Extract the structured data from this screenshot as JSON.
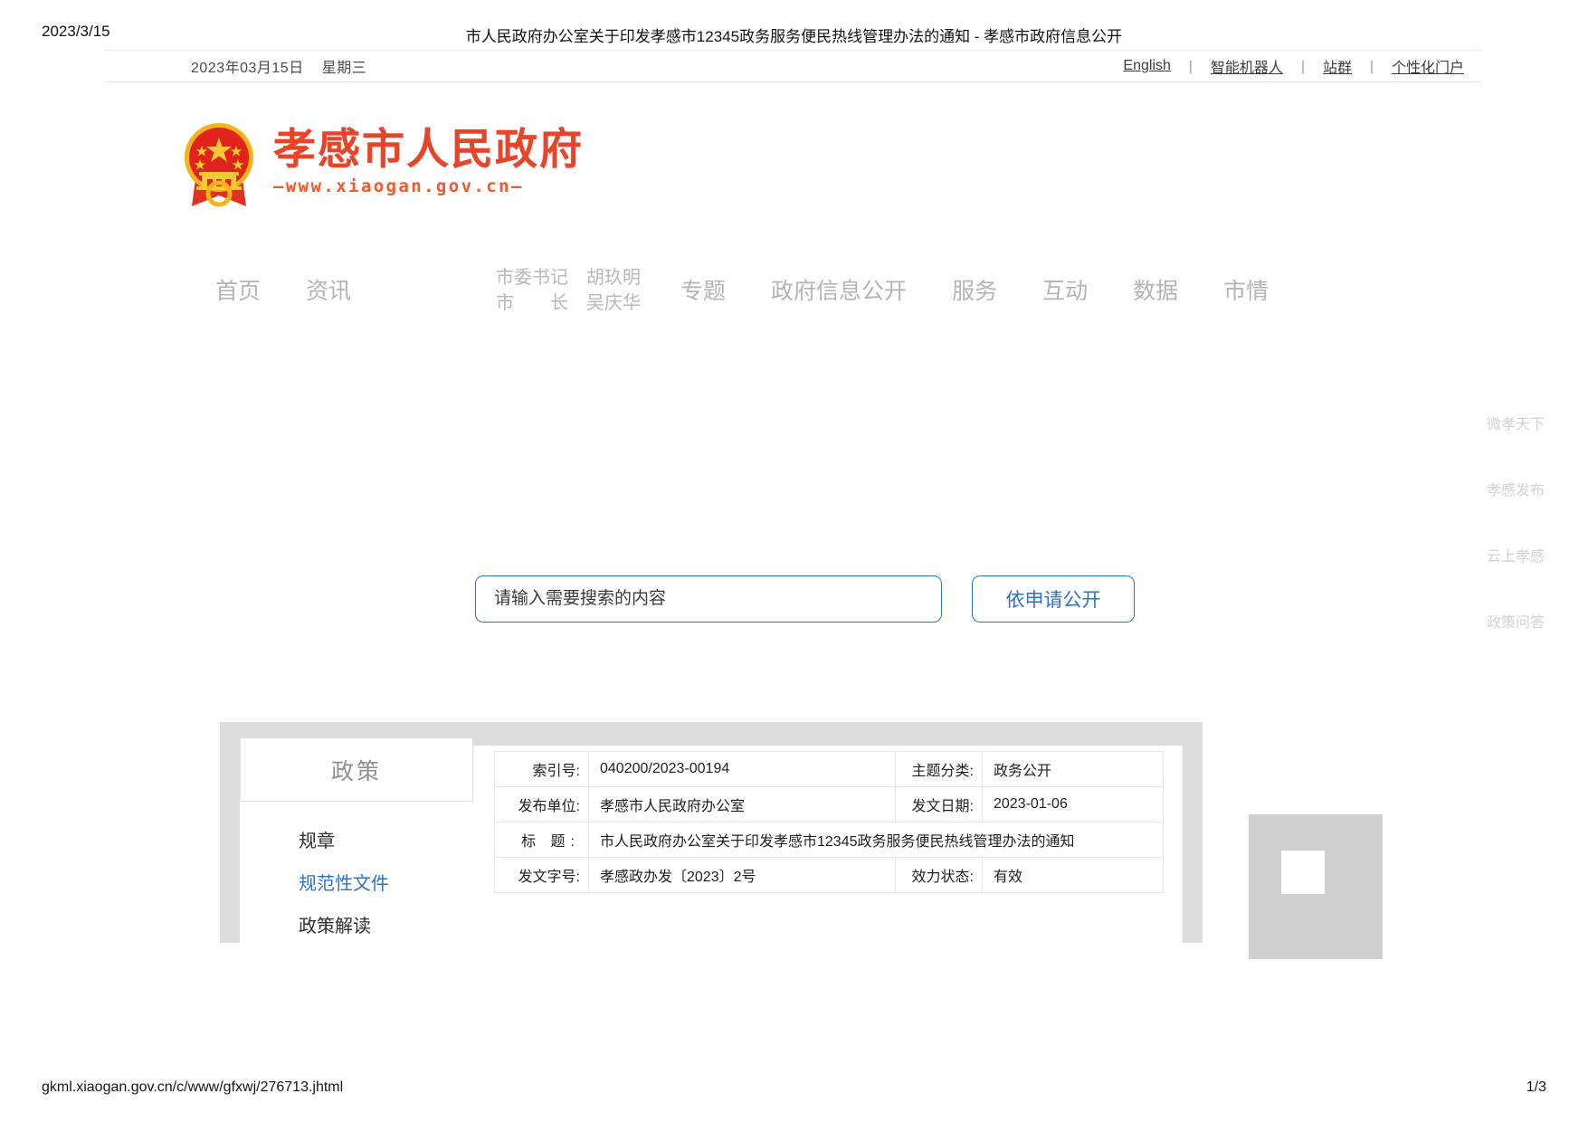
{
  "print": {
    "date": "2023/3/15",
    "title": "市人民政府办公室关于印发孝感市12345政务服务便民热线管理办法的通知 - 孝感市政府信息公开",
    "footer_url": "gkml.xiaogan.gov.cn/c/www/gfxwj/276713.jhtml",
    "page_number": "1/3"
  },
  "topbar": {
    "date": "2023年03月15日",
    "weekday": "星期三",
    "links": [
      "English",
      "智能机器人",
      "站群",
      "个性化门户"
    ],
    "separator": "丨"
  },
  "logo": {
    "emblem_icon": "national-emblem-icon",
    "title": "孝感市人民政府",
    "url": "—www.xiaogan.gov.cn—"
  },
  "nav": {
    "items_left": [
      "首页",
      "资讯"
    ],
    "leaders": [
      {
        "role": "市委书记",
        "name": "胡玖明"
      },
      {
        "role": "市　　长",
        "name": "吴庆华"
      }
    ],
    "items_right": [
      "专题",
      "政府信息公开",
      "服务",
      "互动",
      "数据",
      "市情"
    ]
  },
  "floatbar": {
    "items": [
      "微孝天下",
      "孝感发布",
      "云上孝感",
      "政策问答"
    ]
  },
  "search": {
    "placeholder": "请输入需要搜索的内容",
    "value": "",
    "apply_button": "依申请公开"
  },
  "sidebar": {
    "header": "政策",
    "items": [
      {
        "label": "规章",
        "active": false
      },
      {
        "label": "规范性文件",
        "active": true
      },
      {
        "label": "政策解读",
        "active": false
      }
    ]
  },
  "doc_table": {
    "rows": [
      {
        "label1": "索引号:",
        "value1": "040200/2023-00194",
        "label2": "主题分类:",
        "value2": "政务公开"
      },
      {
        "label1": "发布单位:",
        "value1": "孝感市人民政府办公室",
        "label2": "发文日期:",
        "value2": "2023-01-06"
      },
      {
        "label1": "标 题:",
        "value1": "市人民政府办公室关于印发孝感市12345政务服务便民热线管理办法的通知",
        "label2": "",
        "value2": ""
      },
      {
        "label1": "发文字号:",
        "value1": "孝感政办发〔2023〕2号",
        "label2": "效力状态:",
        "value2": "有效"
      }
    ]
  },
  "colors": {
    "brand_red": "#e8442a",
    "brand_orange": "#ef5a2c",
    "accent_blue": "#2f72c4",
    "nav_gray": "#b4b4b4"
  }
}
